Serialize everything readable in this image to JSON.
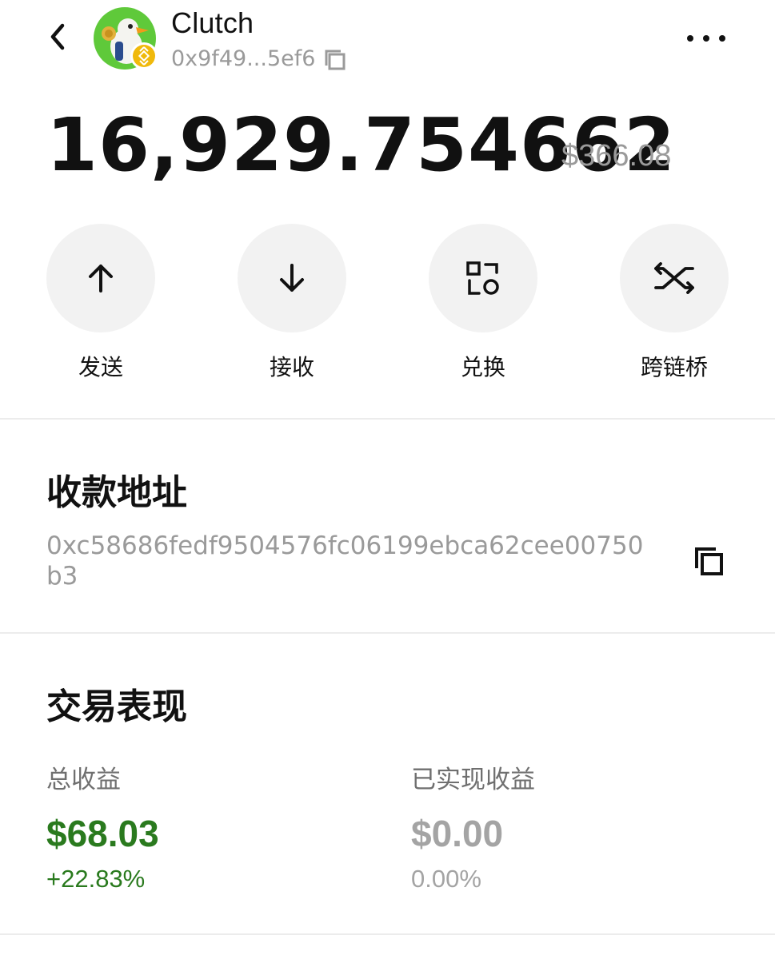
{
  "header": {
    "token_name": "Clutch",
    "address_short": "0x9f49...5ef6",
    "back_icon": "chevron-left-icon",
    "more_icon": "more-horizontal-icon",
    "copy_icon": "copy-icon",
    "avatar_badge": "bnb-chain-badge"
  },
  "balance": {
    "amount": "16,929.754662",
    "usd_value": "$366.08"
  },
  "actions": [
    {
      "label": "发送",
      "icon": "arrow-up-icon"
    },
    {
      "label": "接收",
      "icon": "arrow-down-icon"
    },
    {
      "label": "兑换",
      "icon": "swap-icon"
    },
    {
      "label": "跨链桥",
      "icon": "bridge-icon"
    }
  ],
  "receive_address": {
    "title": "收款地址",
    "address": "0xc58686fedf9504576fc06199ebca62cee00750b3",
    "copy_icon": "copy-icon"
  },
  "performance": {
    "title": "交易表现",
    "total": {
      "label": "总收益",
      "value": "$68.03",
      "pct": "+22.83%",
      "color": "#2a7a1e"
    },
    "realized": {
      "label": "已实现收益",
      "value": "$0.00",
      "pct": "0.00%",
      "color": "#a4a4a4"
    }
  }
}
